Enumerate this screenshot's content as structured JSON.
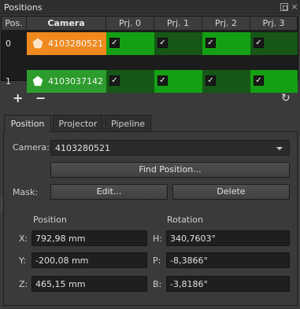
{
  "window": {
    "title": "Positions"
  },
  "grid": {
    "headers": [
      "Pos.",
      "Camera",
      "Prj. 0",
      "Prj. 1",
      "Prj. 2",
      "Prj. 3"
    ],
    "rows": [
      {
        "pos": "0",
        "camera": "4103280521",
        "camera_color": "#f08a1e",
        "checks": [
          "✓",
          "✓",
          "✓",
          "✓"
        ]
      },
      {
        "pos": "1",
        "camera": "4103037142",
        "camera_color": "#2c9c2c",
        "checks": [
          "✓",
          "✓",
          "✓",
          "✓"
        ]
      }
    ]
  },
  "toolbar": {
    "add": "+",
    "remove": "−",
    "refresh": "↻"
  },
  "tabs": [
    {
      "label": "Position",
      "active": true
    },
    {
      "label": "Projector",
      "active": false
    },
    {
      "label": "Pipeline",
      "active": false
    }
  ],
  "position_tab": {
    "camera_label": "Camera:",
    "camera_value": "4103280521",
    "find_button": "Find Position...",
    "mask_label": "Mask:",
    "edit_button": "Edit...",
    "delete_button": "Delete",
    "position_header": "Position",
    "rotation_header": "Rotation",
    "x_label": "X:",
    "x_value": "792,98 mm",
    "y_label": "Y:",
    "y_value": "-200,08 mm",
    "z_label": "Z:",
    "z_value": "465,15 mm",
    "h_label": "H:",
    "h_value": "340,7603°",
    "p_label": "P:",
    "p_value": "-8,3866°",
    "b_label": "B:",
    "b_value": "-3,8186°"
  },
  "colors": {
    "accent_orange": "#f08a1e",
    "accent_green": "#14a014"
  }
}
